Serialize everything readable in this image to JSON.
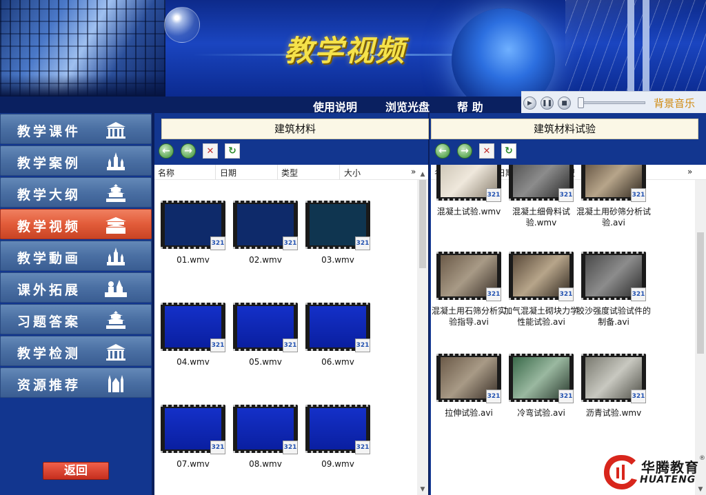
{
  "banner": {
    "title": "教学视频"
  },
  "nav": {
    "items": [
      "使用说明",
      "浏览光盘",
      "帮 助"
    ]
  },
  "music": {
    "label": "背景音乐",
    "buttons": [
      "play-icon",
      "pause-icon",
      "stop-icon"
    ]
  },
  "sidebar": {
    "items": [
      {
        "label": "教学课件",
        "icon": "building-icon",
        "active": false
      },
      {
        "label": "教学案例",
        "icon": "castle-icon",
        "active": false
      },
      {
        "label": "教学大纲",
        "icon": "temple-icon",
        "active": false
      },
      {
        "label": "教学视频",
        "icon": "gate-icon",
        "active": true
      },
      {
        "label": "教学動画",
        "icon": "castle-icon",
        "active": false
      },
      {
        "label": "课外拓展",
        "icon": "landmark-icon",
        "active": false
      },
      {
        "label": "习题答案",
        "icon": "temple-icon",
        "active": false
      },
      {
        "label": "教学检测",
        "icon": "building-icon",
        "active": false
      },
      {
        "label": "资源推荐",
        "icon": "cathedral-icon",
        "active": false
      }
    ],
    "back": "返回"
  },
  "columns": [
    "名称",
    "日期",
    "类型",
    "大小",
    "»"
  ],
  "left_panel": {
    "title": "建筑材料",
    "files": [
      "01.wmv",
      "02.wmv",
      "03.wmv",
      "04.wmv",
      "05.wmv",
      "06.wmv",
      "07.wmv",
      "08.wmv",
      "09.wmv"
    ]
  },
  "right_panel": {
    "title": "建筑材料试验",
    "files": [
      "混凝土试验.wmv",
      "混凝土细骨料试验.wmv",
      "混凝土用砂筛分析试验.avi",
      "混凝土用石筛分析实验指导.avi",
      "加气混凝土砌块力学性能试验.avi",
      "胶沙强度试验试件的制备.avi",
      "拉伸试验.avi",
      "冷弯试验.avi",
      "沥青试验.wmv"
    ]
  },
  "badge": "321",
  "logo": {
    "name": "华腾教育",
    "en": "HUATENG",
    "reg": "®"
  },
  "colors": {
    "banner_blue": "#1a45c0",
    "title_yellow": "#f5e24a",
    "active_menu": "#e25c3a",
    "menu_blue": "#4a6fa3",
    "music_label": "#d08a10"
  }
}
